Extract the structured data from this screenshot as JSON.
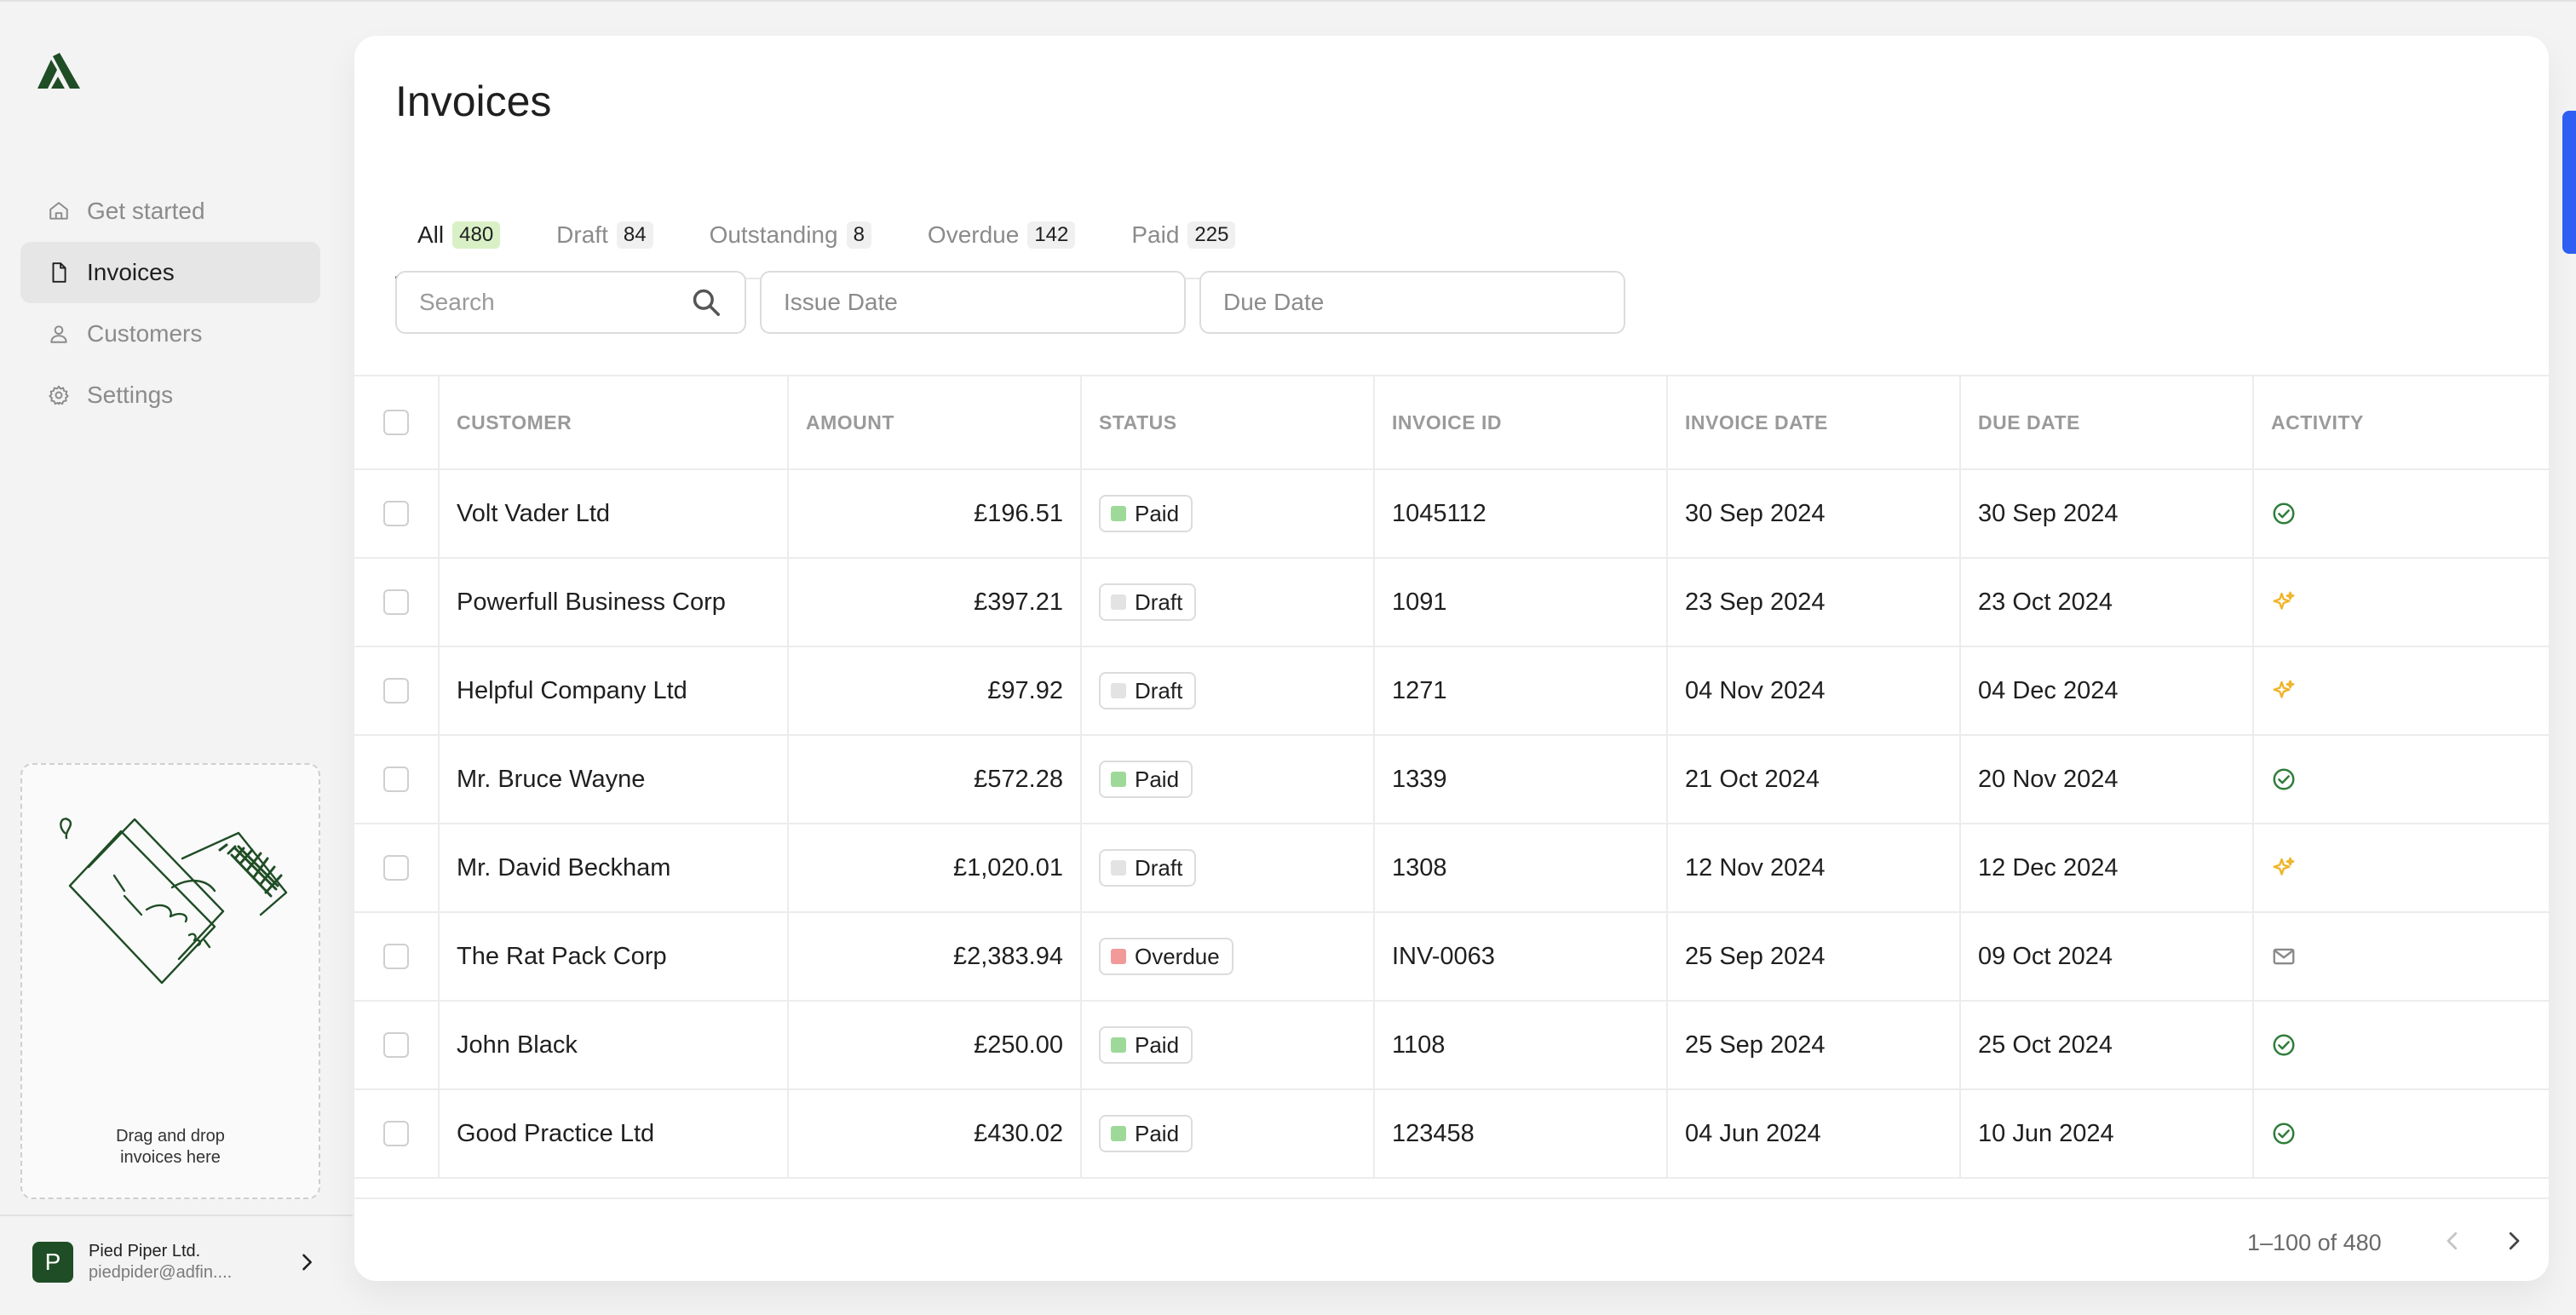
{
  "app": {
    "brand": "logo-icon"
  },
  "sidebar": {
    "items": [
      {
        "label": "Get started",
        "icon": "home-icon"
      },
      {
        "label": "Invoices",
        "icon": "document-icon",
        "active": true
      },
      {
        "label": "Customers",
        "icon": "user-icon"
      },
      {
        "label": "Settings",
        "icon": "gear-icon"
      }
    ],
    "dropzone": {
      "line1": "Drag and drop",
      "line2": "invoices here"
    },
    "account": {
      "initial": "P",
      "name": "Pied Piper Ltd.",
      "email": "piedpider@adfin...."
    }
  },
  "main": {
    "title": "Invoices",
    "tabs": [
      {
        "label": "All",
        "count": "480",
        "active": true
      },
      {
        "label": "Draft",
        "count": "84"
      },
      {
        "label": "Outstanding",
        "count": "8"
      },
      {
        "label": "Overdue",
        "count": "142"
      },
      {
        "label": "Paid",
        "count": "225"
      }
    ],
    "filters": {
      "search_placeholder": "Search",
      "issue_date": "Issue Date",
      "due_date": "Due Date"
    },
    "table": {
      "columns": [
        "CUSTOMER",
        "AMOUNT",
        "STATUS",
        "INVOICE ID",
        "INVOICE DATE",
        "DUE DATE",
        "ACTIVITY"
      ],
      "rows": [
        {
          "customer": "Volt Vader Ltd",
          "amount": "£196.51",
          "status": "Paid",
          "invoice_id": "1045112",
          "invoice_date": "30 Sep 2024",
          "due_date": "30 Sep 2024",
          "activity": "check-circle-icon"
        },
        {
          "customer": "Powerfull Business Corp",
          "amount": "£397.21",
          "status": "Draft",
          "invoice_id": "1091",
          "invoice_date": "23 Sep 2024",
          "due_date": "23 Oct 2024",
          "activity": "sparkle-icon"
        },
        {
          "customer": "Helpful Company Ltd",
          "amount": "£97.92",
          "status": "Draft",
          "invoice_id": "1271",
          "invoice_date": "04 Nov 2024",
          "due_date": "04 Dec 2024",
          "activity": "sparkle-icon"
        },
        {
          "customer": "Mr. Bruce Wayne",
          "amount": "£572.28",
          "status": "Paid",
          "invoice_id": "1339",
          "invoice_date": "21 Oct 2024",
          "due_date": "20 Nov 2024",
          "activity": "check-circle-icon"
        },
        {
          "customer": "Mr. David Beckham",
          "amount": "£1,020.01",
          "status": "Draft",
          "invoice_id": "1308",
          "invoice_date": "12 Nov 2024",
          "due_date": "12 Dec 2024",
          "activity": "sparkle-icon"
        },
        {
          "customer": "The Rat Pack Corp",
          "amount": "£2,383.94",
          "status": "Overdue",
          "invoice_id": "INV-0063",
          "invoice_date": "25 Sep 2024",
          "due_date": "09 Oct 2024",
          "activity": "mail-icon"
        },
        {
          "customer": "John Black",
          "amount": "£250.00",
          "status": "Paid",
          "invoice_id": "1108",
          "invoice_date": "25 Sep 2024",
          "due_date": "25 Oct 2024",
          "activity": "check-circle-icon"
        },
        {
          "customer": "Good Practice Ltd",
          "amount": "£430.02",
          "status": "Paid",
          "invoice_id": "123458",
          "invoice_date": "04 Jun 2024",
          "due_date": "10 Jun 2024",
          "activity": "check-circle-icon"
        }
      ]
    },
    "pagination": {
      "text": "1–100 of 480"
    }
  },
  "colors": {
    "brand": "#1f4d25",
    "paid": "#9fd99a",
    "draft": "#e3e3e3",
    "overdue": "#f29a9a",
    "check_icon": "#2f7d3a",
    "sparkle_icon": "#f0b429",
    "mail_icon": "#8a8a8a",
    "accent_edge": "#2e5ff2"
  }
}
